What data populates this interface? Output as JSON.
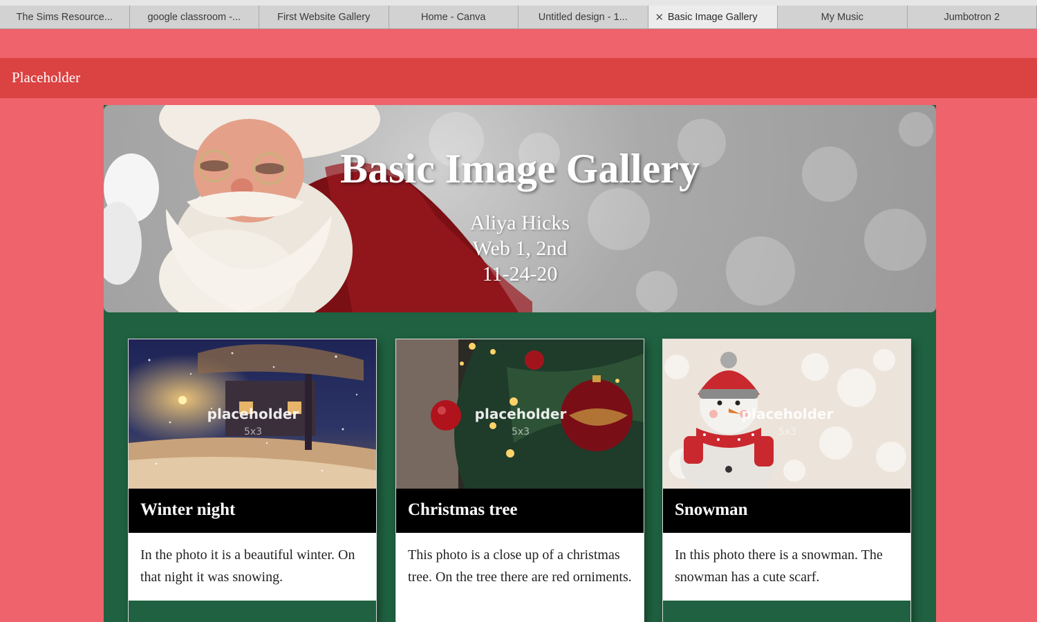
{
  "browser": {
    "tabs": [
      {
        "label": "The Sims Resource..."
      },
      {
        "label": "google classroom -..."
      },
      {
        "label": "First Website Gallery"
      },
      {
        "label": "Home - Canva"
      },
      {
        "label": "Untitled design - 1..."
      },
      {
        "label": "Basic Image Gallery",
        "active": true
      },
      {
        "label": "My Music"
      },
      {
        "label": "Jumbotron 2"
      }
    ]
  },
  "navbar": {
    "brand": "Placeholder"
  },
  "jumbotron": {
    "title": "Basic Image Gallery",
    "line1": "Aliya Hicks",
    "line2": "Web 1, 2nd",
    "line3": "11-24-20"
  },
  "cards": [
    {
      "placeholder": "placeholder",
      "size": "5x3",
      "title": "Winter night",
      "text": "In the photo it is a beautiful winter. On that night it was snowing."
    },
    {
      "placeholder": "placeholder",
      "size": "5x3",
      "title": "Christmas tree",
      "text": "This photo is a close up of a christmas tree. On the tree there are red orniments."
    },
    {
      "placeholder": "placeholder",
      "size": "5x3",
      "title": "Snowman",
      "text": "In this photo there is a snowman. The snowman has a cute scarf."
    }
  ],
  "colors": {
    "page_bg": "#ee636c",
    "navbar_bg": "#db4242",
    "container_bg": "#1f6140",
    "card_title_bg": "#000000"
  }
}
